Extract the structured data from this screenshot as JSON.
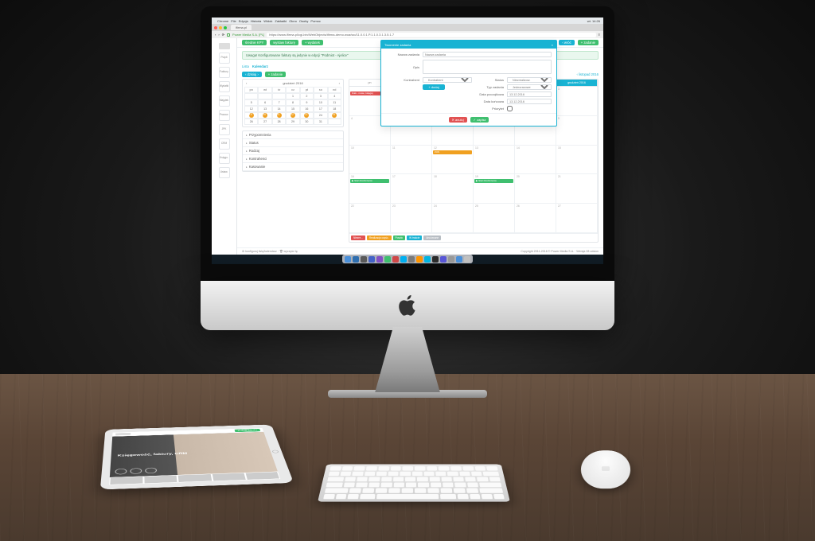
{
  "scene": {
    "description": "Photo of a desk with an Apple iMac displaying a web-based calendar/task app, an iPad showing a marketing website, an Apple wireless keyboard, and an Apple Magic Mouse."
  },
  "macos_menubar": {
    "apple": "",
    "items": [
      "Chrome",
      "File",
      "Edycja",
      "Historia",
      "Widok",
      "Zakładki",
      "Okno",
      "Osoby",
      "Pomoc"
    ],
    "clock": "wt. 14:26"
  },
  "browser": {
    "tab_title": "ifirma.pl",
    "url_prefix": "Power Media S.A. [PL]",
    "url": "https://www.ifirma.pl/cgi-bin/WebObjects/ifirma-demo.woa/wo/11.0.0.1.P.1.1.0.3.1.3.5.1.7"
  },
  "app": {
    "logo": "IFI",
    "sidebar": [
      "Pulpit",
      "Faktury",
      "Wydatki",
      "Majątek",
      "Pracow.",
      "JPK",
      "CRM",
      "Księgo.",
      "Ustaw."
    ],
    "toolbar": {
      "status_btn": "średnie KPY",
      "add_invoice": "wystaw fakturę",
      "add_expense": "+ wydatek"
    },
    "top_right": {
      "back": "‹ wróć",
      "new_task": "+ zadanie"
    },
    "alert_text": "Uwaga! Konfigurowane faktury są jedynie w edycji \"Podmiot - Ajelice\"",
    "tabs": {
      "list": "Lista",
      "calendar": "Kalendarz"
    },
    "subrow": {
      "today": "‹ dzisiaj ›",
      "add": "+ zadanie",
      "prev_month": "‹ listopad 2016",
      "next_month": "grudzień 2016 ›"
    },
    "mini_cal": {
      "month": "grudzień",
      "year": "2016",
      "dow": [
        "pn",
        "wt",
        "śr",
        "cz",
        "pt",
        "so",
        "nd"
      ],
      "days": [
        "",
        "",
        "",
        "1",
        "2",
        "3",
        "4",
        "5",
        "6",
        "7",
        "8",
        "9",
        "10",
        "11",
        "12",
        "13",
        "14",
        "15",
        "16",
        "17",
        "18",
        "19",
        "20",
        "21",
        "22",
        "23",
        "24",
        "25",
        "26",
        "27",
        "28",
        "29",
        "30",
        "31",
        ""
      ],
      "marked": [
        "19",
        "20",
        "21",
        "22",
        "23",
        "25"
      ]
    },
    "accordion": [
      "Przypomnienia",
      "Status",
      "Rodzaj",
      "Kontrahenci",
      "Kasowanie"
    ],
    "calendar": {
      "headers": [
        "pn",
        "wt",
        "śr",
        "cz",
        "pt",
        "so / nd"
      ],
      "right_header": "grudzień 2016",
      "events": {
        "r1c1": {
          "color": "#e15252",
          "text": "brak - nowe, księguj"
        },
        "r3c3": {
          "color": "#f0a020",
          "text": "ZUS"
        },
        "r4c1": {
          "color": "#3fbf6f",
          "text": "▶ Start Rozliczenia"
        },
        "r4c4": {
          "color": "#3fbf6f",
          "text": "▶ Start Rozliczenia"
        }
      },
      "tags": [
        {
          "color": "#e15252",
          "label": "Niezre..."
        },
        {
          "color": "#f0a020",
          "label": "Realizacja częśc."
        },
        {
          "color": "#3fbf6f",
          "label": "Poszło"
        },
        {
          "color": "#19b3d3",
          "label": "W trakcie"
        },
        {
          "color": "#b8bec4",
          "label": "Anulowane"
        }
      ]
    },
    "footer": {
      "left": "⚙ konfiguruj listę/kalendarz · 🗑 wyczyść tę",
      "right": "Copyright 2011-2016 © Power Media S.A. · Wersja 28 odsłon"
    }
  },
  "modal": {
    "title": "Tworzenie zadania",
    "fields": {
      "name_label": "Nazwa zadania",
      "name_placeholder": "Nazwa zadania",
      "desc_label": "Opis",
      "kontrahent_label": "Kontrahent",
      "kontrahent_value": "Kontrahent",
      "dodaj_btn": "+ dodaj",
      "status_label": "Status",
      "status_value": "Niezrealizow.",
      "typ_label": "Typ zadania",
      "typ_value": "Jednorazowe",
      "data_label": "Data początkowa",
      "data_value": "13.12.2016",
      "data_kon_label": "Data końcowa",
      "data_kon_value": "13.12.2016",
      "priorytet_label": "Priorytet"
    },
    "buttons": {
      "cancel": "✕ anuluj",
      "save": "✓ zapisz"
    }
  },
  "dock_colors": [
    "#4a90d9",
    "#2f6fb0",
    "#5a5a5a",
    "#4463c7",
    "#8250c4",
    "#3fbf6f",
    "#d04848",
    "#00aff0",
    "#7b7b7b",
    "#ff9500",
    "#00b5e2",
    "#2c2c2c",
    "#5856d6",
    "#999999",
    "#4a90d9",
    "#c0c0c0"
  ],
  "tablet": {
    "nav_btn": "Załóż konto",
    "hero": "Księgowość, faktury, CRM"
  }
}
